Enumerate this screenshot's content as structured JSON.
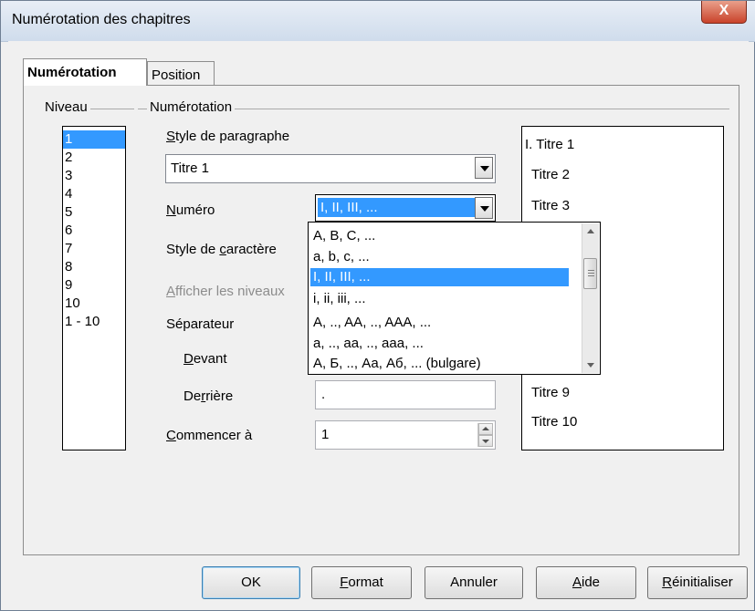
{
  "window": {
    "title": "Numérotation des chapitres",
    "close_label": "X"
  },
  "tabs": [
    {
      "label": "Numérotation",
      "active": true
    },
    {
      "label": "Position",
      "active": false
    }
  ],
  "niveau": {
    "legend": "Niveau",
    "items": [
      "1",
      "2",
      "3",
      "4",
      "5",
      "6",
      "7",
      "8",
      "9",
      "10",
      "1 - 10"
    ],
    "selected": "1"
  },
  "numerotation": {
    "legend": "Numérotation",
    "style_paragraphe": {
      "label": "Style de paragraphe",
      "value": "Titre 1"
    },
    "numero": {
      "label": "Numéro",
      "value": "I, II, III, ...",
      "options": [
        "A, B, C, ...",
        "a, b, c, ...",
        "I, II, III, ...",
        "i, ii, iii, ...",
        "A, .., AA, .., AAA, ...",
        "a, .., aa, .., aaa, ...",
        "А, Б, .., Аа, Аб, ... (bulgare)"
      ],
      "selected_index": 2
    },
    "style_caractere": {
      "label": "Style de caractère"
    },
    "afficher_niveaux": {
      "label": "Afficher les niveaux"
    },
    "separateur": {
      "label": "Séparateur",
      "devant": {
        "label": "Devant"
      },
      "derriere": {
        "label": "Derrière",
        "value": "."
      }
    },
    "commencer": {
      "label": "Commencer à",
      "value": "1"
    }
  },
  "preview": {
    "lines": [
      "I. Titre 1",
      "Titre 2",
      "Titre 3",
      "Titre 9",
      "Titre 10"
    ]
  },
  "buttons": {
    "ok": "OK",
    "format": "Format",
    "annuler": "Annuler",
    "aide": "Aide",
    "reinitialiser": "Réinitialiser"
  },
  "colors": {
    "selection": "#3399ff",
    "dialog_bg": "#f0f0f0",
    "close_button": "#c9432b"
  }
}
